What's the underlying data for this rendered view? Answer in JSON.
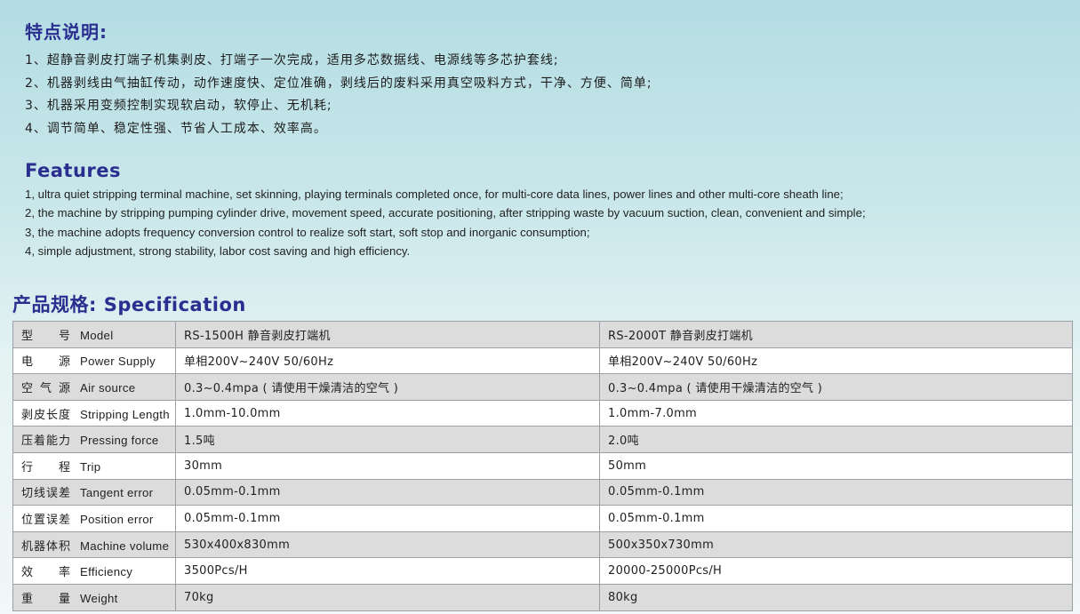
{
  "features_cn": {
    "title": "特点说明:",
    "items": [
      "1、超静音剥皮打端子机集剥皮、打端子一次完成，适用多芯数据线、电源线等多芯护套线;",
      "2、机器剥线由气抽缸传动，动作速度快、定位准确，剥线后的废料采用真空吸料方式，干净、方便、简单;",
      "3、机器采用变频控制实现软启动，软停止、无机耗;",
      "4、调节简单、稳定性强、节省人工成本、效率高。"
    ]
  },
  "features_en": {
    "title": "Features",
    "items": [
      "1, ultra quiet stripping terminal machine, set skinning, playing terminals completed once, for multi-core data lines, power lines and other multi-core sheath line;",
      "2, the machine by stripping pumping cylinder drive, movement speed, accurate positioning, after stripping waste by vacuum suction, clean, convenient and simple;",
      "3, the machine adopts frequency conversion control to realize soft start, soft stop and inorganic consumption;",
      "4, simple adjustment, strong stability, labor cost saving and high efficiency."
    ]
  },
  "spec": {
    "title": "产品规格: Specification",
    "rows": [
      {
        "cn": "型号",
        "en": "Model",
        "a": "RS-1500H 静音剥皮打端机",
        "b": "RS-2000T 静音剥皮打端机"
      },
      {
        "cn": "电源",
        "en": "Power Supply",
        "a": "单相200V~240V 50/60Hz",
        "b": "单相200V~240V 50/60Hz"
      },
      {
        "cn": "空气源",
        "en": "Air source",
        "a": "0.3~0.4mpa ( 请使用干燥清洁的空气 )",
        "b": "0.3~0.4mpa ( 请使用干燥清洁的空气 )"
      },
      {
        "cn": "剥皮长度",
        "en": "Stripping Length",
        "a": "1.0mm-10.0mm",
        "b": "1.0mm-7.0mm"
      },
      {
        "cn": "压着能力",
        "en": "Pressing force",
        "a": "1.5吨",
        "b": "2.0吨"
      },
      {
        "cn": "行程",
        "en": "Trip",
        "a": "30mm",
        "b": "50mm"
      },
      {
        "cn": "切线误差",
        "en": "Tangent error",
        "a": "0.05mm-0.1mm",
        "b": "0.05mm-0.1mm"
      },
      {
        "cn": "位置误差",
        "en": "Position error",
        "a": "0.05mm-0.1mm",
        "b": "0.05mm-0.1mm"
      },
      {
        "cn": "机器体积",
        "en": "Machine volume",
        "a": "530x400x830mm",
        "b": "500x350x730mm"
      },
      {
        "cn": "效率",
        "en": "Efficiency",
        "a": "3500Pcs/H",
        "b": "20000-25000Pcs/H"
      },
      {
        "cn": "重量",
        "en": "Weight",
        "a": "70kg",
        "b": "80kg"
      }
    ]
  }
}
